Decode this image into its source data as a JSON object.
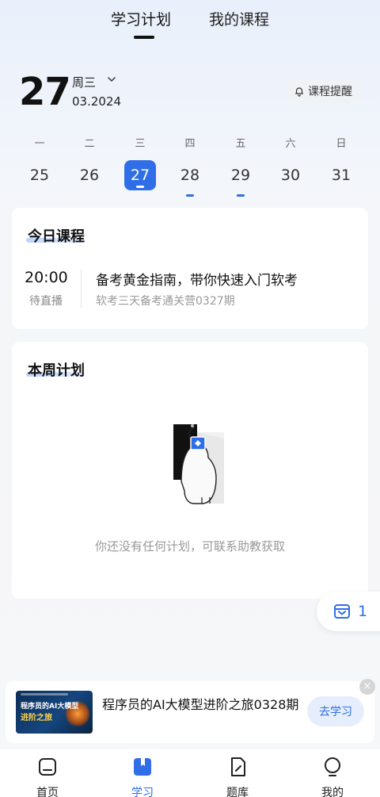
{
  "header": {
    "tabs": [
      {
        "label": "学习计划",
        "active": true
      },
      {
        "label": "我的课程",
        "active": false
      }
    ]
  },
  "date": {
    "day": "27",
    "weekday": "周三",
    "month": "03.2024"
  },
  "reminder": {
    "label": "课程提醒",
    "icon": "bell-icon"
  },
  "week": {
    "labels": [
      "一",
      "二",
      "三",
      "四",
      "五",
      "六",
      "日"
    ],
    "days": [
      {
        "num": "25",
        "selected": false,
        "has_course": false
      },
      {
        "num": "26",
        "selected": false,
        "has_course": false
      },
      {
        "num": "27",
        "selected": true,
        "has_course": true
      },
      {
        "num": "28",
        "selected": false,
        "has_course": true
      },
      {
        "num": "29",
        "selected": false,
        "has_course": true
      },
      {
        "num": "30",
        "selected": false,
        "has_course": false
      },
      {
        "num": "31",
        "selected": false,
        "has_course": false
      }
    ]
  },
  "today": {
    "title": "今日课程",
    "time": "20:00",
    "status": "待直播",
    "course_title": "备考黄金指南，带你快速入门软考",
    "course_sub": "软考三天备考通关营0327期"
  },
  "week_plan": {
    "title": "本周计划",
    "empty_text": "你还没有任何计划，可联系助教获取"
  },
  "float": {
    "count": "1",
    "icon": "inbox-icon"
  },
  "promo": {
    "title": "程序员的AI大模型进阶之旅0328期",
    "button": "去学习",
    "close": "×",
    "thumb_line1": "程序员的AI大模型",
    "thumb_line2": "进阶之旅"
  },
  "tabbar": [
    {
      "label": "首页",
      "icon": "home-icon",
      "active": false
    },
    {
      "label": "学习",
      "icon": "book-icon",
      "active": true
    },
    {
      "label": "题库",
      "icon": "edit-icon",
      "active": false
    },
    {
      "label": "我的",
      "icon": "profile-icon",
      "active": false
    }
  ],
  "colors": {
    "accent": "#2f6ee6",
    "text": "#111111",
    "muted": "#999999"
  }
}
